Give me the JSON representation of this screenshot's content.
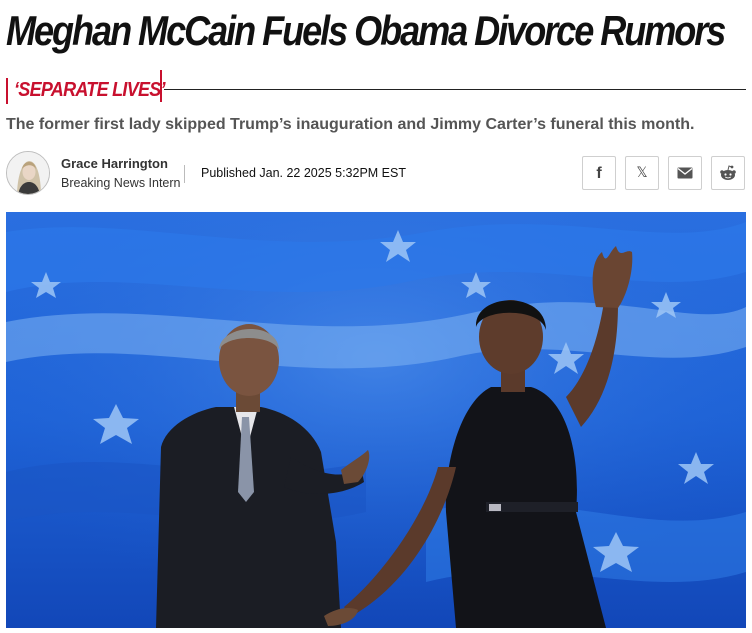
{
  "article": {
    "headline": "Meghan McCain Fuels Obama Divorce Rumors",
    "kicker": "‘SEPARATE LIVES’",
    "dek": "The former first lady skipped Trump’s inauguration and Jimmy Carter’s funeral this month."
  },
  "byline": {
    "author_name": "Grace Harrington",
    "author_role": "Breaking News Intern",
    "published": "Published Jan. 22 2025 5:32PM EST"
  },
  "share": {
    "facebook_glyph": "f",
    "x_glyph": "𝕏",
    "icons": [
      "facebook-icon",
      "x-icon",
      "email-icon",
      "reddit-icon"
    ]
  },
  "colors": {
    "kicker_accent": "#c8102e",
    "headline": "#111111",
    "dek": "#555555",
    "hero_background": "#1d63d8"
  }
}
